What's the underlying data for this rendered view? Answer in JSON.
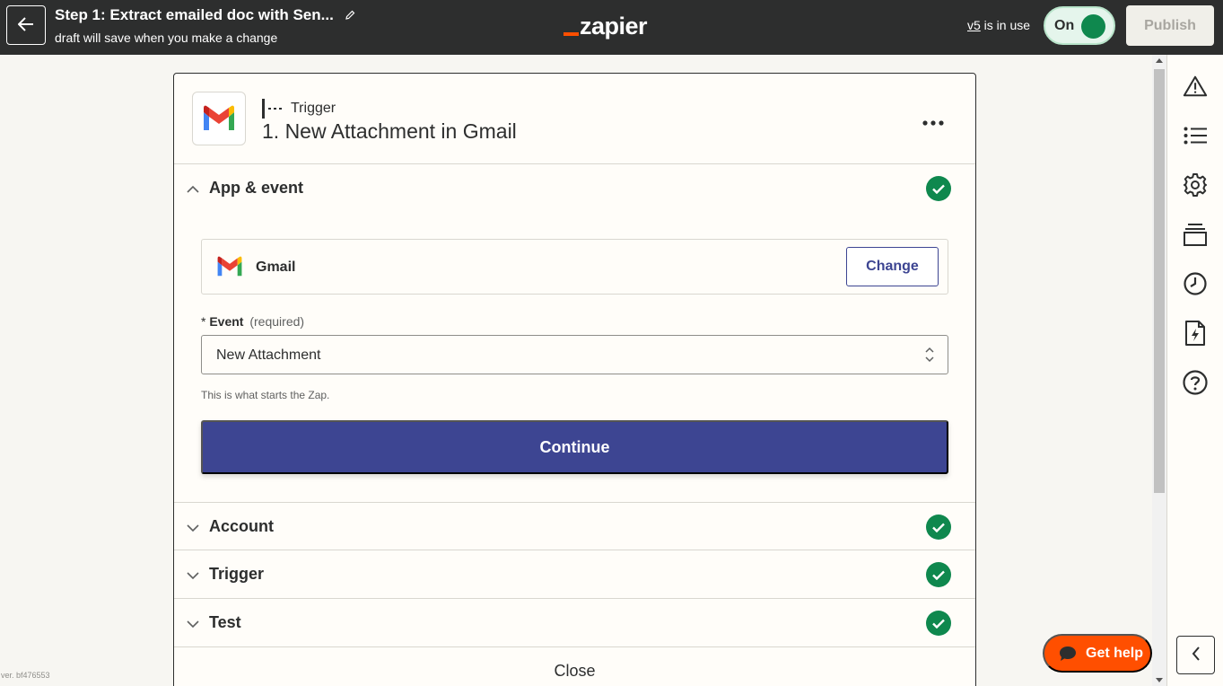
{
  "header": {
    "back_icon": "arrow-left-icon",
    "zap_title": "Step 1: Extract emailed doc with Sen...",
    "edit_icon": "pencil-icon",
    "subtitle": "draft will save when you make a change",
    "logo_text": "zapier",
    "version_link": "v5",
    "version_suffix": " is in use",
    "toggle_label": "On",
    "publish_label": "Publish"
  },
  "step": {
    "app_icon": "gmail-icon",
    "type_label": "Trigger",
    "title": "1. New Attachment in Gmail",
    "more_icon": "more-horizontal-icon"
  },
  "sections": {
    "app_event": {
      "label": "App & event",
      "app_name": "Gmail",
      "change_label": "Change",
      "event_label": "Event",
      "event_required_marker": "*",
      "event_required_text": "(required)",
      "event_value": "New Attachment",
      "helper_text": "This is what starts the Zap.",
      "continue_label": "Continue"
    },
    "account": {
      "label": "Account"
    },
    "trigger": {
      "label": "Trigger"
    },
    "test": {
      "label": "Test"
    },
    "close_label": "Close"
  },
  "sidebar": {
    "icons": [
      "warning-icon",
      "list-icon",
      "settings-gear-icon",
      "versions-stack-icon",
      "history-clock-icon",
      "zap-file-icon",
      "help-circle-icon"
    ],
    "collapse_icon": "chevron-left-icon"
  },
  "footer": {
    "version_text": "ver. bf476553",
    "help_label": "Get help"
  },
  "colors": {
    "topbar": "#2d2e2e",
    "accent": "#3d4592",
    "success": "#0f884e",
    "brand_orange": "#ff4f00"
  }
}
